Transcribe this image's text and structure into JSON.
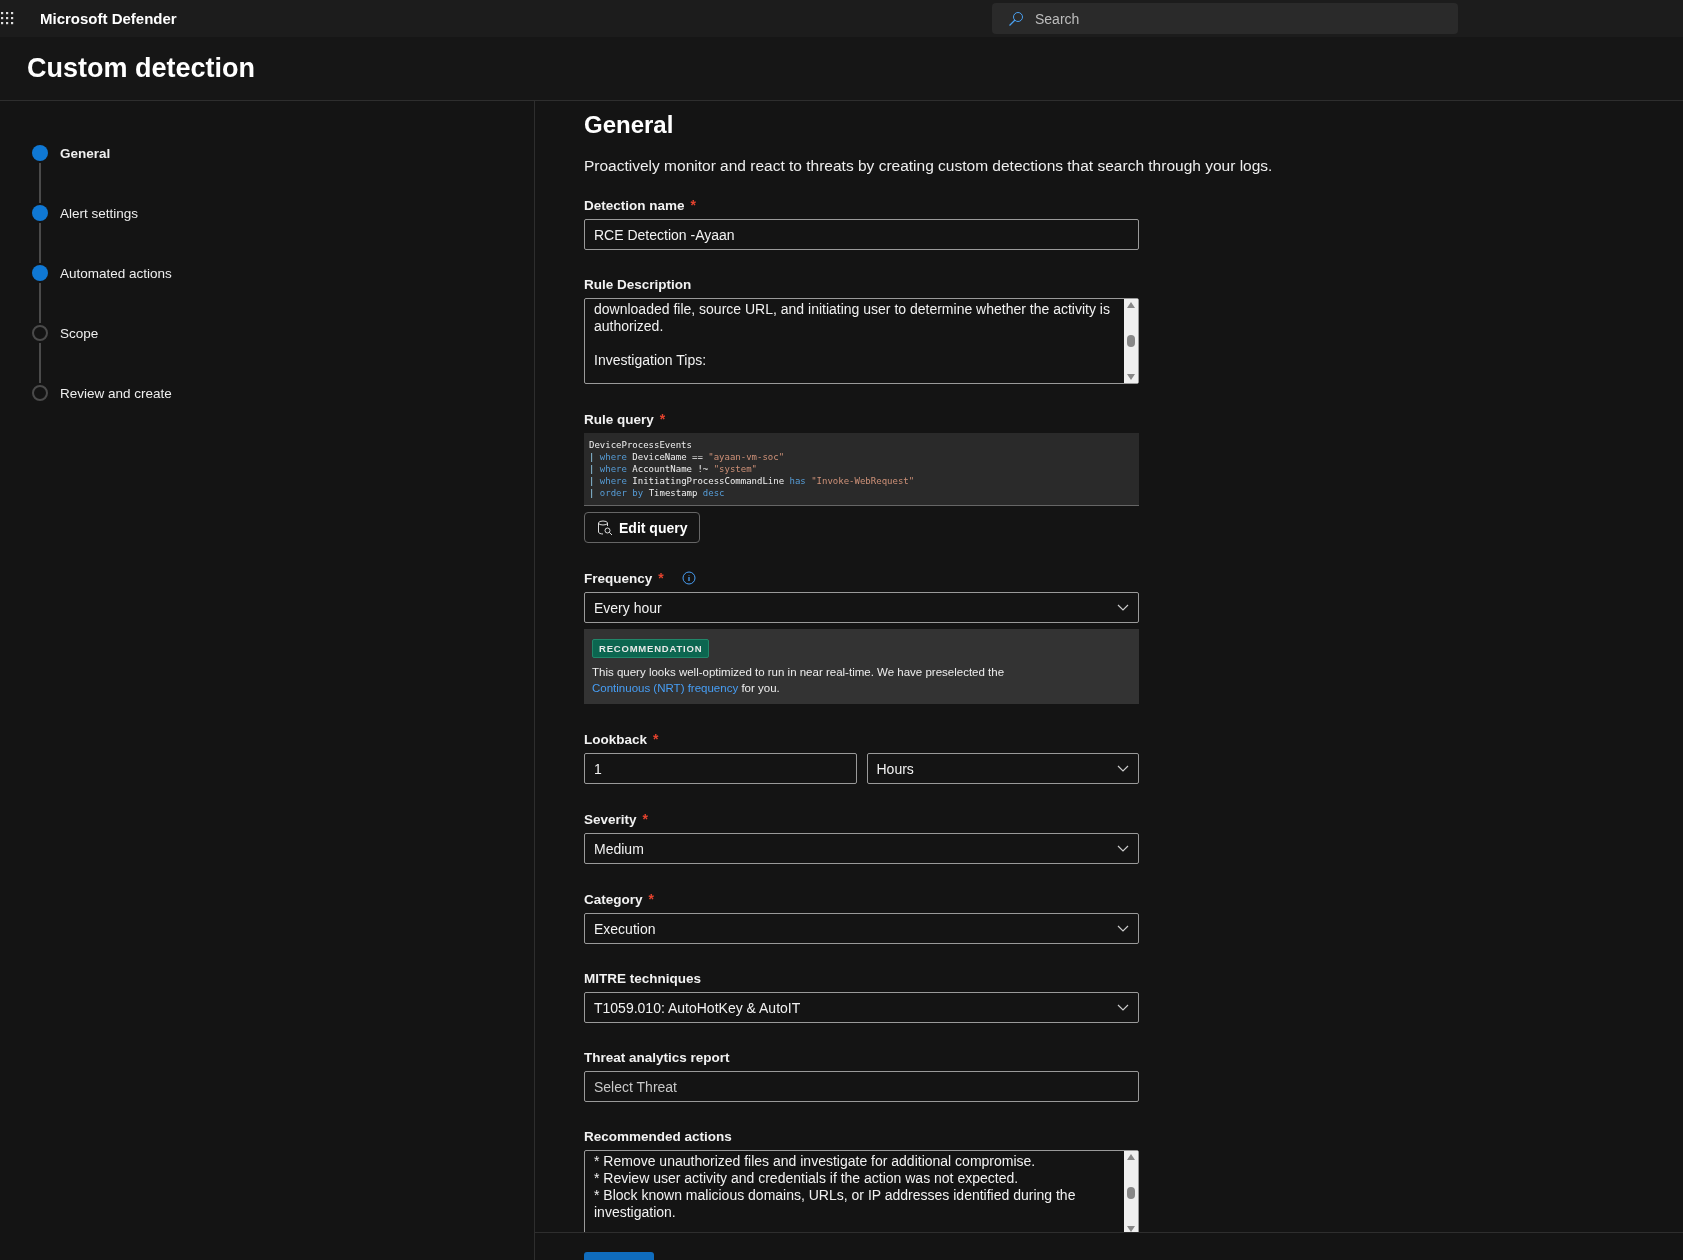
{
  "app": {
    "name": "Microsoft Defender"
  },
  "search": {
    "placeholder": "Search"
  },
  "page_title": "Custom detection",
  "steps": [
    {
      "label": "General",
      "selected": true,
      "done": true
    },
    {
      "label": "Alert settings",
      "selected": false,
      "done": true
    },
    {
      "label": "Automated actions",
      "selected": false,
      "done": true
    },
    {
      "label": "Scope",
      "selected": false,
      "done": false
    },
    {
      "label": "Review and create",
      "selected": false,
      "done": false
    }
  ],
  "section": {
    "title": "General",
    "intro": "Proactively monitor and react to threats by creating custom detections that search through your logs."
  },
  "fields": [
    {
      "kind": "text",
      "label": "Detection name",
      "required_mark": "*",
      "value": "RCE Detection -Ayaan"
    },
    {
      "kind": "textarea",
      "label": "Rule Description",
      "value": "downloaded file, source URL, and initiating user to determine whether the activity is authorized.\n\nInvestigation Tips:"
    },
    {
      "kind": "code",
      "label": "Rule query",
      "required_mark": "*",
      "button": "Edit query",
      "lines": [
        [
          {
            "kind": "plain",
            "text": "DeviceProcessEvents"
          }
        ],
        [
          {
            "kind": "pipe",
            "text": "|"
          },
          {
            "kind": "keyword",
            "text": "where"
          },
          {
            "kind": "plain",
            "text": "DeviceName =="
          },
          {
            "kind": "string",
            "text": "\"ayaan-vm-soc\""
          }
        ],
        [
          {
            "kind": "pipe",
            "text": "|"
          },
          {
            "kind": "keyword",
            "text": "where"
          },
          {
            "kind": "plain",
            "text": "AccountName !~"
          },
          {
            "kind": "string",
            "text": "\"system\""
          }
        ],
        [
          {
            "kind": "pipe",
            "text": "|"
          },
          {
            "kind": "keyword",
            "text": "where"
          },
          {
            "kind": "plain",
            "text": "InitiatingProcessCommandLine"
          },
          {
            "kind": "keyword",
            "text": "has"
          },
          {
            "kind": "string",
            "text": "\"Invoke-WebRequest\""
          }
        ],
        [
          {
            "kind": "pipe",
            "text": "|"
          },
          {
            "kind": "keyword",
            "text": "order by"
          },
          {
            "kind": "plain",
            "text": "Timestamp"
          },
          {
            "kind": "keyword",
            "text": "desc"
          }
        ]
      ]
    },
    {
      "kind": "select",
      "label": "Frequency",
      "required_mark": "*",
      "info": true,
      "value": "Every hour",
      "recommendation": {
        "badge": "RECOMMENDATION",
        "text": "This query looks well-optimized to run in near real-time. We have preselected the",
        "link": "Continuous (NRT) frequency",
        "after": "for you."
      }
    },
    {
      "kind": "pair",
      "label": "Lookback",
      "required_mark": "*",
      "value": "1",
      "unit": "Hours"
    },
    {
      "kind": "select",
      "label": "Severity",
      "required_mark": "*",
      "value": "Medium"
    },
    {
      "kind": "select",
      "label": "Category",
      "required_mark": "*",
      "value": "Execution"
    },
    {
      "kind": "select",
      "label": "MITRE techniques",
      "value": "T1059.010: AutoHotKey & AutoIT"
    },
    {
      "kind": "text",
      "label": "Threat analytics report",
      "placeholder": "Select Threat"
    },
    {
      "kind": "textarea",
      "label": "Recommended actions",
      "value": "* Remove unauthorized files and investigate for additional compromise.\n* Review user activity and credentials if the action was not expected.\n* Block known malicious domains, URLs, or IP addresses identified during the investigation."
    }
  ]
}
